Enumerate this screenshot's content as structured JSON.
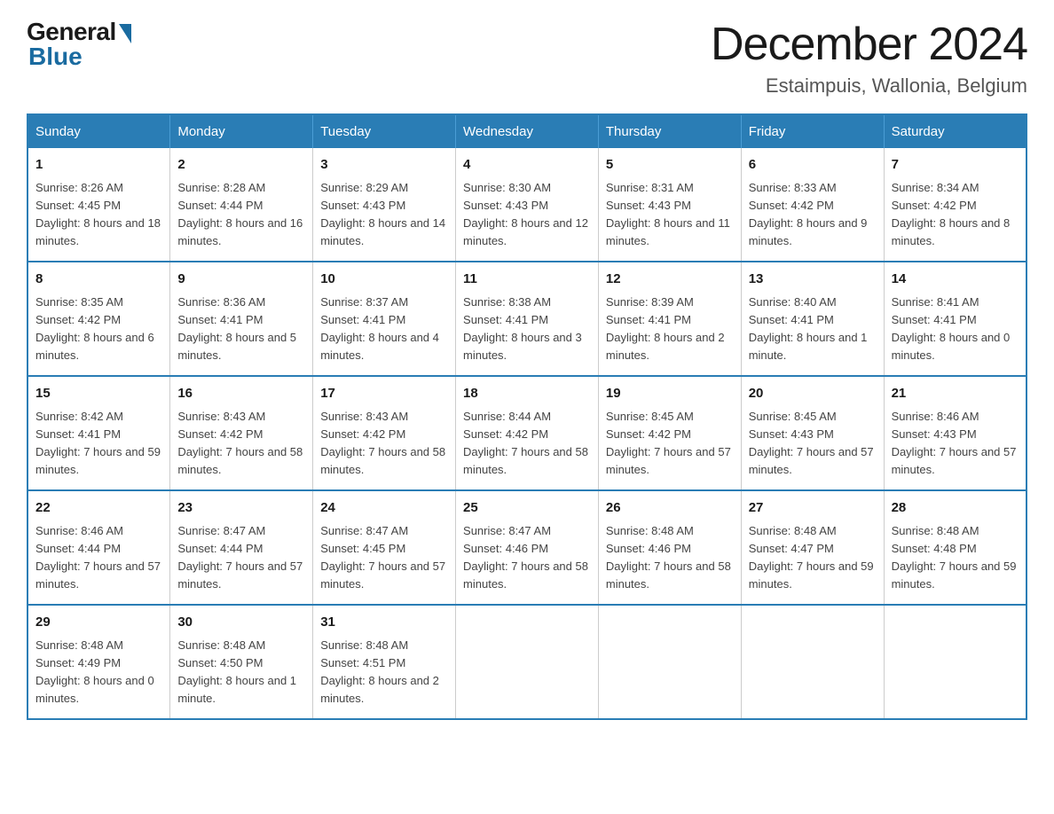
{
  "logo": {
    "general": "General",
    "blue": "Blue"
  },
  "header": {
    "month_year": "December 2024",
    "location": "Estaimpuis, Wallonia, Belgium"
  },
  "days_of_week": [
    "Sunday",
    "Monday",
    "Tuesday",
    "Wednesday",
    "Thursday",
    "Friday",
    "Saturday"
  ],
  "weeks": [
    [
      {
        "day": "1",
        "sunrise": "Sunrise: 8:26 AM",
        "sunset": "Sunset: 4:45 PM",
        "daylight": "Daylight: 8 hours and 18 minutes."
      },
      {
        "day": "2",
        "sunrise": "Sunrise: 8:28 AM",
        "sunset": "Sunset: 4:44 PM",
        "daylight": "Daylight: 8 hours and 16 minutes."
      },
      {
        "day": "3",
        "sunrise": "Sunrise: 8:29 AM",
        "sunset": "Sunset: 4:43 PM",
        "daylight": "Daylight: 8 hours and 14 minutes."
      },
      {
        "day": "4",
        "sunrise": "Sunrise: 8:30 AM",
        "sunset": "Sunset: 4:43 PM",
        "daylight": "Daylight: 8 hours and 12 minutes."
      },
      {
        "day": "5",
        "sunrise": "Sunrise: 8:31 AM",
        "sunset": "Sunset: 4:43 PM",
        "daylight": "Daylight: 8 hours and 11 minutes."
      },
      {
        "day": "6",
        "sunrise": "Sunrise: 8:33 AM",
        "sunset": "Sunset: 4:42 PM",
        "daylight": "Daylight: 8 hours and 9 minutes."
      },
      {
        "day": "7",
        "sunrise": "Sunrise: 8:34 AM",
        "sunset": "Sunset: 4:42 PM",
        "daylight": "Daylight: 8 hours and 8 minutes."
      }
    ],
    [
      {
        "day": "8",
        "sunrise": "Sunrise: 8:35 AM",
        "sunset": "Sunset: 4:42 PM",
        "daylight": "Daylight: 8 hours and 6 minutes."
      },
      {
        "day": "9",
        "sunrise": "Sunrise: 8:36 AM",
        "sunset": "Sunset: 4:41 PM",
        "daylight": "Daylight: 8 hours and 5 minutes."
      },
      {
        "day": "10",
        "sunrise": "Sunrise: 8:37 AM",
        "sunset": "Sunset: 4:41 PM",
        "daylight": "Daylight: 8 hours and 4 minutes."
      },
      {
        "day": "11",
        "sunrise": "Sunrise: 8:38 AM",
        "sunset": "Sunset: 4:41 PM",
        "daylight": "Daylight: 8 hours and 3 minutes."
      },
      {
        "day": "12",
        "sunrise": "Sunrise: 8:39 AM",
        "sunset": "Sunset: 4:41 PM",
        "daylight": "Daylight: 8 hours and 2 minutes."
      },
      {
        "day": "13",
        "sunrise": "Sunrise: 8:40 AM",
        "sunset": "Sunset: 4:41 PM",
        "daylight": "Daylight: 8 hours and 1 minute."
      },
      {
        "day": "14",
        "sunrise": "Sunrise: 8:41 AM",
        "sunset": "Sunset: 4:41 PM",
        "daylight": "Daylight: 8 hours and 0 minutes."
      }
    ],
    [
      {
        "day": "15",
        "sunrise": "Sunrise: 8:42 AM",
        "sunset": "Sunset: 4:41 PM",
        "daylight": "Daylight: 7 hours and 59 minutes."
      },
      {
        "day": "16",
        "sunrise": "Sunrise: 8:43 AM",
        "sunset": "Sunset: 4:42 PM",
        "daylight": "Daylight: 7 hours and 58 minutes."
      },
      {
        "day": "17",
        "sunrise": "Sunrise: 8:43 AM",
        "sunset": "Sunset: 4:42 PM",
        "daylight": "Daylight: 7 hours and 58 minutes."
      },
      {
        "day": "18",
        "sunrise": "Sunrise: 8:44 AM",
        "sunset": "Sunset: 4:42 PM",
        "daylight": "Daylight: 7 hours and 58 minutes."
      },
      {
        "day": "19",
        "sunrise": "Sunrise: 8:45 AM",
        "sunset": "Sunset: 4:42 PM",
        "daylight": "Daylight: 7 hours and 57 minutes."
      },
      {
        "day": "20",
        "sunrise": "Sunrise: 8:45 AM",
        "sunset": "Sunset: 4:43 PM",
        "daylight": "Daylight: 7 hours and 57 minutes."
      },
      {
        "day": "21",
        "sunrise": "Sunrise: 8:46 AM",
        "sunset": "Sunset: 4:43 PM",
        "daylight": "Daylight: 7 hours and 57 minutes."
      }
    ],
    [
      {
        "day": "22",
        "sunrise": "Sunrise: 8:46 AM",
        "sunset": "Sunset: 4:44 PM",
        "daylight": "Daylight: 7 hours and 57 minutes."
      },
      {
        "day": "23",
        "sunrise": "Sunrise: 8:47 AM",
        "sunset": "Sunset: 4:44 PM",
        "daylight": "Daylight: 7 hours and 57 minutes."
      },
      {
        "day": "24",
        "sunrise": "Sunrise: 8:47 AM",
        "sunset": "Sunset: 4:45 PM",
        "daylight": "Daylight: 7 hours and 57 minutes."
      },
      {
        "day": "25",
        "sunrise": "Sunrise: 8:47 AM",
        "sunset": "Sunset: 4:46 PM",
        "daylight": "Daylight: 7 hours and 58 minutes."
      },
      {
        "day": "26",
        "sunrise": "Sunrise: 8:48 AM",
        "sunset": "Sunset: 4:46 PM",
        "daylight": "Daylight: 7 hours and 58 minutes."
      },
      {
        "day": "27",
        "sunrise": "Sunrise: 8:48 AM",
        "sunset": "Sunset: 4:47 PM",
        "daylight": "Daylight: 7 hours and 59 minutes."
      },
      {
        "day": "28",
        "sunrise": "Sunrise: 8:48 AM",
        "sunset": "Sunset: 4:48 PM",
        "daylight": "Daylight: 7 hours and 59 minutes."
      }
    ],
    [
      {
        "day": "29",
        "sunrise": "Sunrise: 8:48 AM",
        "sunset": "Sunset: 4:49 PM",
        "daylight": "Daylight: 8 hours and 0 minutes."
      },
      {
        "day": "30",
        "sunrise": "Sunrise: 8:48 AM",
        "sunset": "Sunset: 4:50 PM",
        "daylight": "Daylight: 8 hours and 1 minute."
      },
      {
        "day": "31",
        "sunrise": "Sunrise: 8:48 AM",
        "sunset": "Sunset: 4:51 PM",
        "daylight": "Daylight: 8 hours and 2 minutes."
      },
      null,
      null,
      null,
      null
    ]
  ]
}
